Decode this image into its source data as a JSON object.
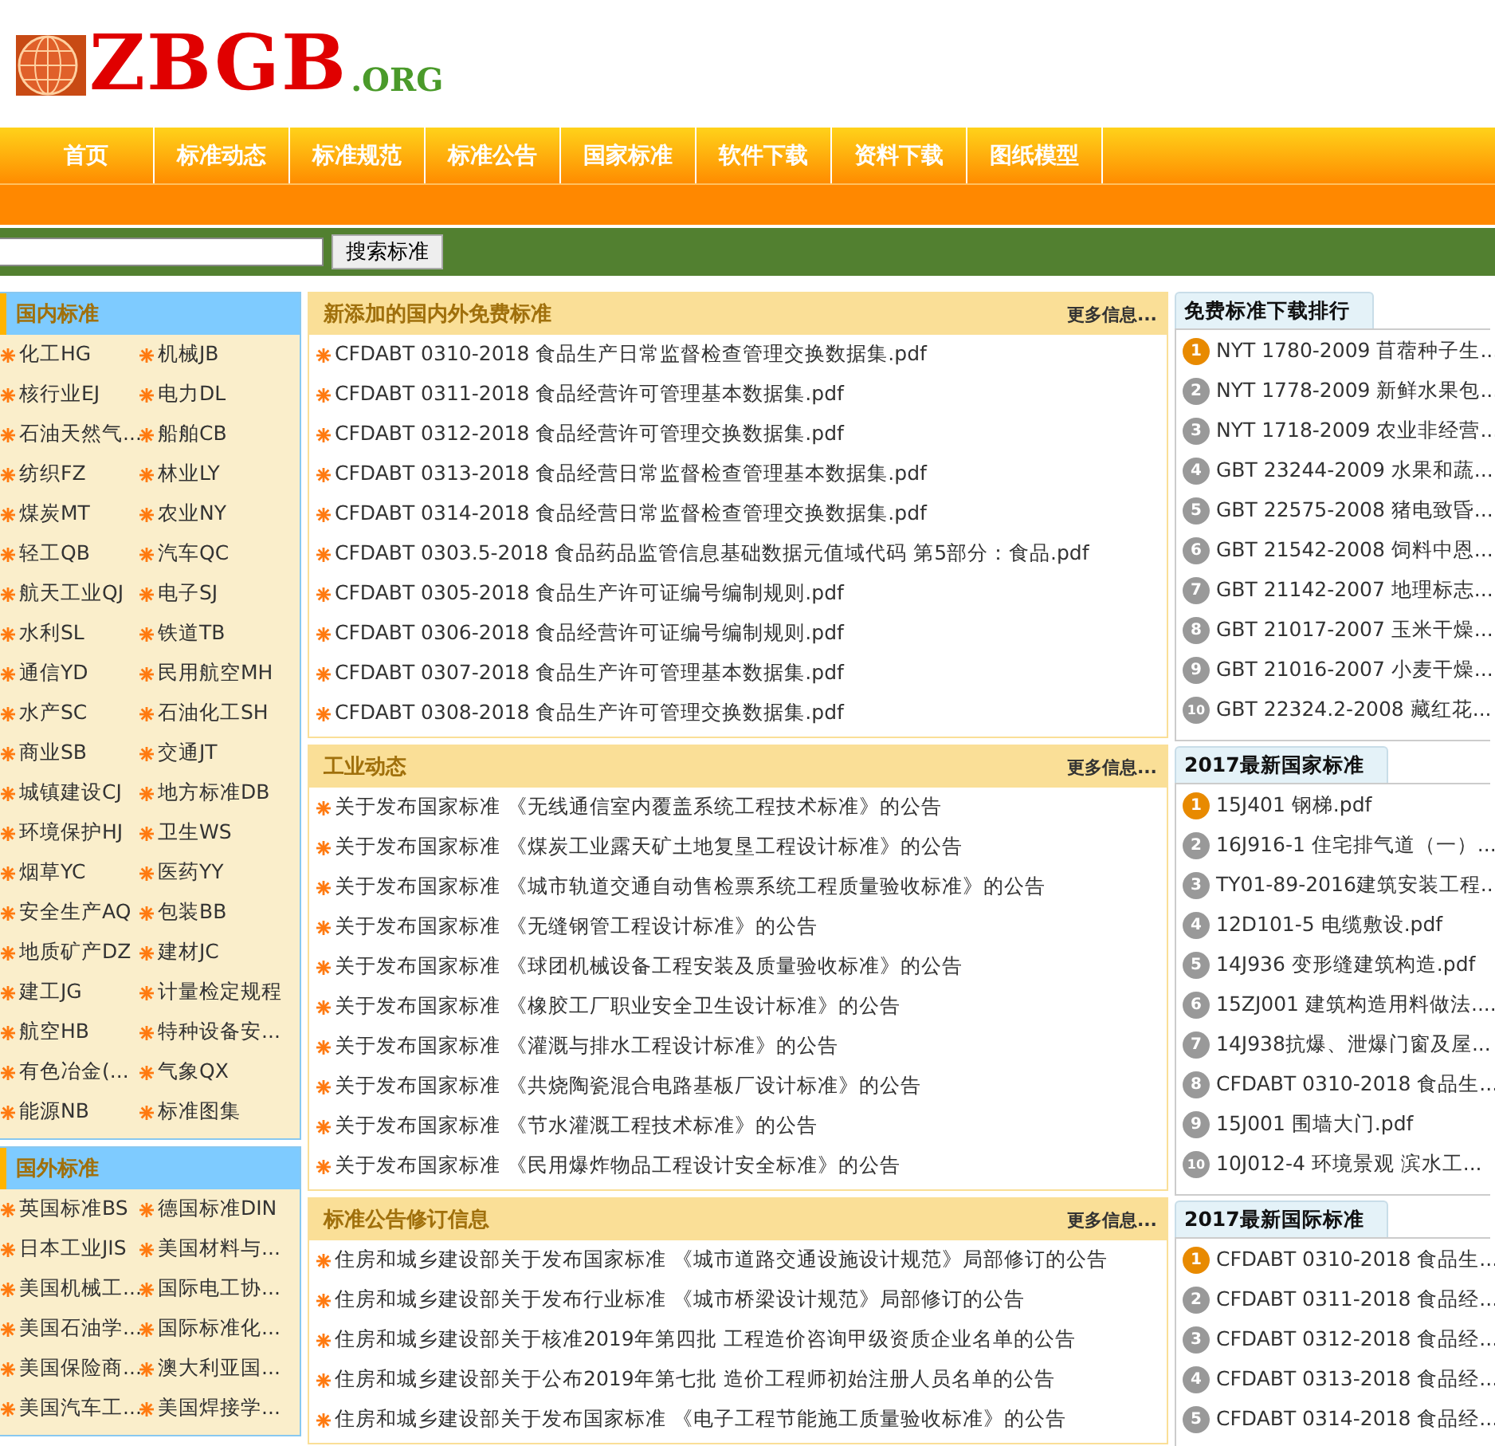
{
  "logo": {
    "name": "ZBGB",
    "suffix": ".ORG"
  },
  "nav": [
    {
      "label": "首页",
      "selected": false
    },
    {
      "label": "标准动态",
      "selected": false
    },
    {
      "label": "标准规范",
      "selected": false
    },
    {
      "label": "标准公告",
      "selected": false
    },
    {
      "label": "国家标准",
      "selected": false
    },
    {
      "label": "软件下载",
      "selected": false
    },
    {
      "label": "资料下载",
      "selected": false
    },
    {
      "label": "图纸模型",
      "selected": false
    }
  ],
  "search": {
    "button": "搜索标准"
  },
  "sidebar": [
    {
      "title": "国内标准",
      "items": [
        "化工HG",
        "机械JB",
        "核行业EJ",
        "电力DL",
        "石油天然气...",
        "船舶CB",
        "纺织FZ",
        "林业LY",
        "煤炭MT",
        "农业NY",
        "轻工QB",
        "汽车QC",
        "航天工业QJ",
        "电子SJ",
        "水利SL",
        "铁道TB",
        "通信YD",
        "民用航空MH",
        "水产SC",
        "石油化工SH",
        "商业SB",
        "交通JT",
        "城镇建设CJ",
        "地方标准DB",
        "环境保护HJ",
        "卫生WS",
        "烟草YC",
        "医药YY",
        "安全生产AQ",
        "包装BB",
        "地质矿产DZ",
        "建材JC",
        "建工JG",
        "计量检定规程",
        "航空HB",
        "特种设备安...",
        "有色冶金(...",
        "气象QX",
        "能源NB",
        "标准图集"
      ]
    },
    {
      "title": "国外标准",
      "items": [
        "英国标准BS",
        "德国标准DIN",
        "日本工业JIS",
        "美国材料与...",
        "美国机械工...",
        "国际电工协...",
        "美国石油学...",
        "国际标准化...",
        "美国保险商...",
        "澳大利亚国...",
        "美国汽车工...",
        "美国焊接学..."
      ]
    }
  ],
  "sections": [
    {
      "title": "新添加的国内外免费标准",
      "more": "更多信息...",
      "items": [
        "CFDABT 0310-2018 食品生产日常监督检查管理交换数据集.pdf",
        "CFDABT 0311-2018 食品经营许可管理基本数据集.pdf",
        "CFDABT 0312-2018 食品经营许可管理交换数据集.pdf",
        "CFDABT 0313-2018 食品经营日常监督检查管理基本数据集.pdf",
        "CFDABT 0314-2018 食品经营日常监督检查管理交换数据集.pdf",
        "CFDABT 0303.5-2018 食品药品监管信息基础数据元值域代码 第5部分：食品.pdf",
        "CFDABT 0305-2018 食品生产许可证编号编制规则.pdf",
        "CFDABT 0306-2018 食品经营许可证编号编制规则.pdf",
        "CFDABT 0307-2018 食品生产许可管理基本数据集.pdf",
        "CFDABT 0308-2018 食品生产许可管理交换数据集.pdf"
      ]
    },
    {
      "title": "工业动态",
      "more": "更多信息...",
      "items": [
        "关于发布国家标准 《无线通信室内覆盖系统工程技术标准》的公告",
        "关于发布国家标准 《煤炭工业露天矿土地复垦工程设计标准》的公告",
        "关于发布国家标准 《城市轨道交通自动售检票系统工程质量验收标准》的公告",
        "关于发布国家标准 《无缝钢管工程设计标准》的公告",
        "关于发布国家标准 《球团机械设备工程安装及质量验收标准》的公告",
        "关于发布国家标准 《橡胶工厂职业安全卫生设计标准》的公告",
        "关于发布国家标准 《灌溉与排水工程设计标准》的公告",
        "关于发布国家标准 《共烧陶瓷混合电路基板厂设计标准》的公告",
        "关于发布国家标准 《节水灌溉工程技术标准》的公告",
        "关于发布国家标准 《民用爆炸物品工程设计安全标准》的公告"
      ]
    },
    {
      "title": "标准公告修订信息",
      "more": "更多信息...",
      "items": [
        "住房和城乡建设部关于发布国家标准 《城市道路交通设施设计规范》局部修订的公告",
        "住房和城乡建设部关于发布行业标准 《城市桥梁设计规范》局部修订的公告",
        "住房和城乡建设部关于核准2019年第四批 工程造价咨询甲级资质企业名单的公告",
        "住房和城乡建设部关于公布2019年第七批 造价工程师初始注册人员名单的公告",
        "住房和城乡建设部关于发布国家标准 《电子工程节能施工质量验收标准》的公告"
      ]
    }
  ],
  "rankings": [
    {
      "title": "免费标准下载排行",
      "items": [
        {
          "rank": "1",
          "top": true,
          "text": "NYT 1780-2009 苜蓿种子生..."
        },
        {
          "rank": "2",
          "top": false,
          "text": "NYT 1778-2009 新鲜水果包..."
        },
        {
          "rank": "3",
          "top": false,
          "text": "NYT 1718-2009 农业非经营..."
        },
        {
          "rank": "4",
          "top": false,
          "text": "GBT 23244-2009 水果和蔬..."
        },
        {
          "rank": "5",
          "top": false,
          "text": "GBT 22575-2008 猪电致昏..."
        },
        {
          "rank": "6",
          "top": false,
          "text": "GBT 21542-2008 饲料中恩..."
        },
        {
          "rank": "7",
          "top": false,
          "text": "GBT 21142-2007 地理标志..."
        },
        {
          "rank": "8",
          "top": false,
          "text": "GBT 21017-2007 玉米干燥..."
        },
        {
          "rank": "9",
          "top": false,
          "text": "GBT 21016-2007 小麦干燥..."
        },
        {
          "rank": "10",
          "top": false,
          "text": "GBT 22324.2-2008 藏红花..."
        }
      ]
    },
    {
      "title": "2017最新国家标准",
      "items": [
        {
          "rank": "1",
          "top": true,
          "text": "15J401 钢梯.pdf"
        },
        {
          "rank": "2",
          "top": false,
          "text": "16J916-1 住宅排气道（一）..."
        },
        {
          "rank": "3",
          "top": false,
          "text": "TY01-89-2016建筑安装工程..."
        },
        {
          "rank": "4",
          "top": false,
          "text": "12D101-5 电缆敷设.pdf"
        },
        {
          "rank": "5",
          "top": false,
          "text": "14J936 变形缝建筑构造.pdf"
        },
        {
          "rank": "6",
          "top": false,
          "text": "15ZJ001 建筑构造用料做法...."
        },
        {
          "rank": "7",
          "top": false,
          "text": "14J938抗爆、泄爆门窗及屋..."
        },
        {
          "rank": "8",
          "top": false,
          "text": "CFDABT 0310-2018 食品生..."
        },
        {
          "rank": "9",
          "top": false,
          "text": "15J001 围墙大门.pdf"
        },
        {
          "rank": "10",
          "top": false,
          "text": "10J012-4 环境景观 滨水工..."
        }
      ]
    },
    {
      "title": "2017最新国际标准",
      "items": [
        {
          "rank": "1",
          "top": true,
          "text": "CFDABT 0310-2018 食品生..."
        },
        {
          "rank": "2",
          "top": false,
          "text": "CFDABT 0311-2018 食品经..."
        },
        {
          "rank": "3",
          "top": false,
          "text": "CFDABT 0312-2018 食品经..."
        },
        {
          "rank": "4",
          "top": false,
          "text": "CFDABT 0313-2018 食品经..."
        },
        {
          "rank": "5",
          "top": false,
          "text": "CFDABT 0314-2018 食品经..."
        }
      ]
    }
  ]
}
